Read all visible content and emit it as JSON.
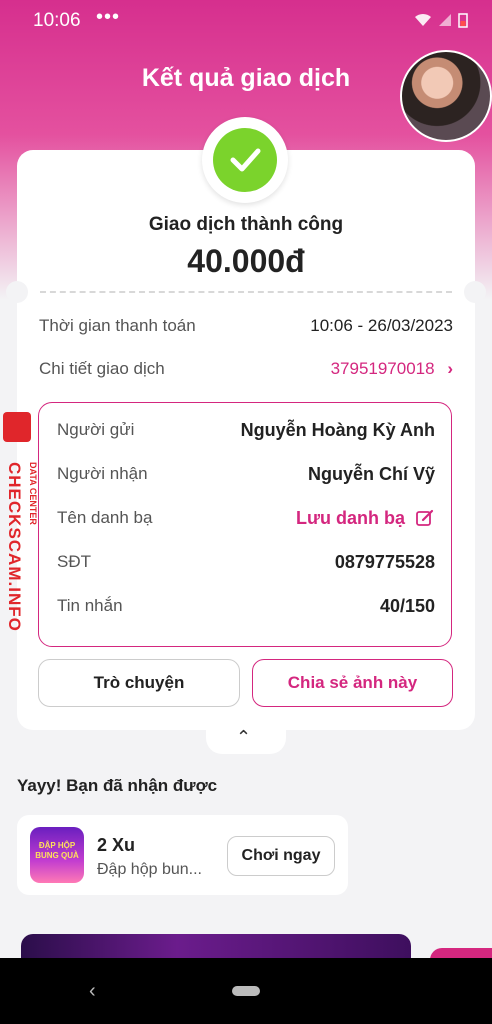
{
  "status_bar": {
    "time": "10:06",
    "dots": "•••"
  },
  "header": {
    "title": "Kết quả giao dịch"
  },
  "result": {
    "status": "Giao dịch thành công",
    "amount": "40.000đ"
  },
  "summary": {
    "time_label": "Thời gian thanh toán",
    "time_value": "10:06 - 26/03/2023",
    "detail_label": "Chi tiết giao dịch",
    "detail_value": "37951970018"
  },
  "details": {
    "sender_label": "Người gửi",
    "sender_value": "Nguyễn Hoàng Kỳ Anh",
    "receiver_label": "Người nhận",
    "receiver_value": "Nguyễn Chí Vỹ",
    "contact_label": "Tên danh bạ",
    "contact_value": "Lưu danh bạ",
    "phone_label": "SĐT",
    "phone_value": "0879775528",
    "message_label": "Tin nhắn",
    "message_value": "40/150"
  },
  "buttons": {
    "chat": "Trò chuyện",
    "share": "Chia sẻ ảnh này"
  },
  "rewards": {
    "heading": "Yayy! Bạn đã nhận được",
    "item_title": "2 Xu",
    "item_sub": "Đập hộp bun...",
    "play_label": "Chơi ngay",
    "game_icon_text": "ĐẬP HỘP BUNG QUÀ"
  },
  "watermark": {
    "text": "CHECKSCAM.INFO",
    "sub": "DATA CENTER"
  },
  "colors": {
    "accent": "#d4277f",
    "success": "#7bd32c",
    "header_gradient": "#d62f8e"
  }
}
